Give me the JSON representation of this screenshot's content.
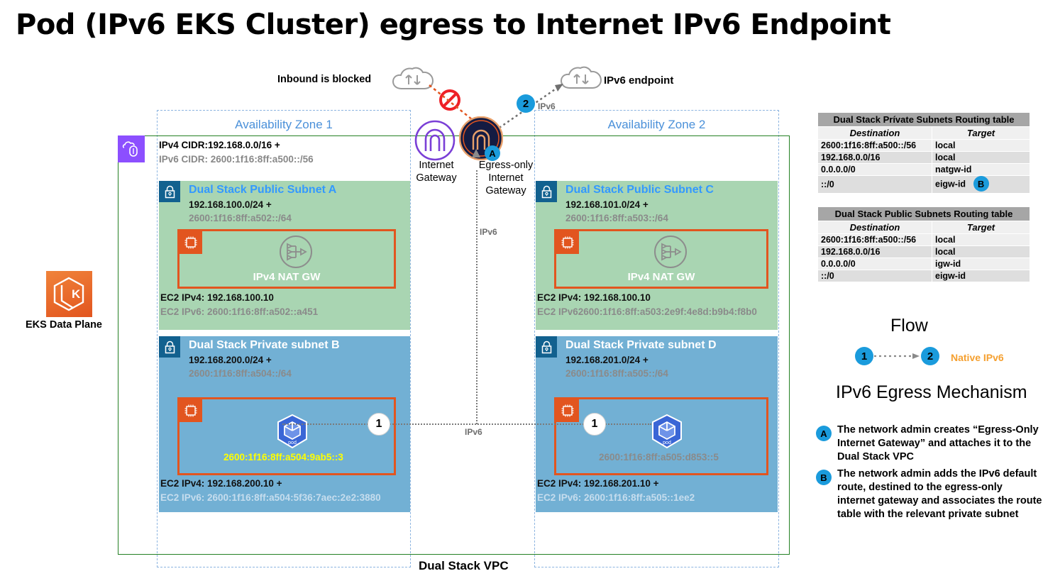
{
  "title": "Pod (IPv6 EKS Cluster) egress to Internet IPv6 Endpoint",
  "labels": {
    "inbound_blocked": "Inbound is blocked",
    "ipv6_endpoint": "IPv6 endpoint",
    "internet_gateway": "Internet\nGateway",
    "internet_gateway_l1": "Internet",
    "internet_gateway_l2": "Gateway",
    "eigw_l1": "Egress-only",
    "eigw_l2": "Internet",
    "eigw_l3": "Gateway",
    "eigw_badge": "A",
    "step2": "2",
    "ipv6_tag": "IPv6",
    "eks_data_plane": "EKS Data Plane",
    "vpc_name": "Dual Stack VPC",
    "az1": "Availability Zone 1",
    "az2": "Availability Zone 2",
    "vpc_cidr4": "IPv4 CIDR:192.168.0.0/16 +",
    "vpc_cidr6": "IPv6 CIDR: 2600:1f16:8ff:a500::/56"
  },
  "subnets": [
    {
      "id": "subnet-a",
      "name": "Dual Stack Public Subnet A",
      "cidr4": "192.168.100.0/24 +",
      "cidr6": "2600:1f16:8ff:a502::/64",
      "resource_label": "IPv4 NAT GW",
      "ec2_ip4": "EC2 IPv4: 192.168.100.10",
      "ec2_ip6": "EC2 IPv6: 2600:1f16:8ff:a502::a451"
    },
    {
      "id": "subnet-c",
      "name": "Dual Stack Public Subnet C",
      "cidr4": "192.168.101.0/24 +",
      "cidr6": "2600:1f16:8ff:a503::/64",
      "resource_label": "IPv4 NAT GW",
      "ec2_ip4": "EC2 IPv4: 192.168.100.10",
      "ec2_ip6": "EC2 IPv62600:1f16:8ff:a503:2e9f:4e8d:b9b4:f8b0"
    },
    {
      "id": "subnet-b",
      "name": "Dual Stack Private subnet B",
      "cidr4": "192.168.200.0/24 +",
      "cidr6": "2600:1f16:8ff:a504::/64",
      "pod_ip": "2600:1f16:8ff:a504:9ab5::3",
      "pod_ip_color": "#ffff00",
      "step": "1",
      "ec2_ip4": "EC2 IPv4: 192.168.200.10 +",
      "ec2_ip6": "EC2 IPv6: 2600:1f16:8ff:a504:5f36:7aec:2e2:3880"
    },
    {
      "id": "subnet-d",
      "name": "Dual Stack Private subnet D",
      "cidr4": "192.168.201.0/24 +",
      "cidr6": "2600:1f16:8ff:a505::/64",
      "pod_ip": "2600:1f16:8ff:a505:d853::5",
      "pod_ip_color": "#8a8a8a",
      "step": "1",
      "ec2_ip4": "EC2 IPv4: 192.168.201.10 +",
      "ec2_ip6": "EC2 IPv6: 2600:1f16:8ff:a505::1ee2"
    }
  ],
  "routing_tables": [
    {
      "id": "private-rt",
      "title": "Dual Stack Prívate Subnets Routing table",
      "columns": [
        "Destination",
        "Target"
      ],
      "rows": [
        {
          "destination": "2600:1f16:8ff:a500::/56",
          "target": "local",
          "badge": ""
        },
        {
          "destination": "192.168.0.0/16",
          "target": "local",
          "badge": ""
        },
        {
          "destination": "0.0.0.0/0",
          "target": "natgw-id",
          "badge": ""
        },
        {
          "destination": "::/0",
          "target": "eigw-id",
          "badge": "B"
        }
      ]
    },
    {
      "id": "public-rt",
      "title": "Dual Stack Public Subnets Routing table",
      "columns": [
        "Destination",
        "Target"
      ],
      "rows": [
        {
          "destination": "2600:1f16:8ff:a500::/56",
          "target": "local",
          "badge": ""
        },
        {
          "destination": "192.168.0.0/16",
          "target": "local",
          "badge": ""
        },
        {
          "destination": "0.0.0.0/0",
          "target": "igw-id",
          "badge": ""
        },
        {
          "destination": "::/0",
          "target": "eigw-id",
          "badge": ""
        }
      ]
    }
  ],
  "flow": {
    "title": "Flow",
    "step1": "1",
    "step2": "2",
    "legend": "Native IPv6",
    "legend_color": "#f5a030"
  },
  "mechanism": {
    "title": "IPv6 Egress Mechanism",
    "items": [
      {
        "badge": "A",
        "text": "The network admin creates “Egress-Only Internet Gateway” and attaches it to the Dual Stack VPC"
      },
      {
        "badge": "B",
        "text": "The network admin adds the IPv6 default route, destined to the egress-only internet gateway and associates the route table with the relevant private subnet"
      }
    ]
  },
  "colors": {
    "public_subnet": "#a9d5b2",
    "private_subnet": "#72b0d4",
    "vpc_border": "#248023",
    "az_border": "#8cb4e0",
    "ec2_border": "#e2551f",
    "accent_blue": "#1a9bdc",
    "subnet_title_blue": "#3399ff",
    "eigw_purple": "#7a3fd6"
  }
}
